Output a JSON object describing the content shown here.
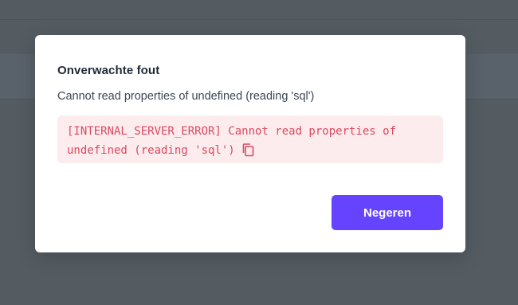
{
  "dialog": {
    "title": "Onverwachte fout",
    "message": "Cannot read properties of undefined (reading 'sql')",
    "error_detail": "[INTERNAL_SERVER_ERROR] Cannot read properties of undefined (reading 'sql')",
    "copy_icon": "copy-icon",
    "ignore_label": "Negeren"
  },
  "colors": {
    "backdrop": "#545c62",
    "dialog_background": "#ffffff",
    "error_background": "#fdecee",
    "error_text": "#d94a60",
    "primary_button": "#6644ff"
  }
}
